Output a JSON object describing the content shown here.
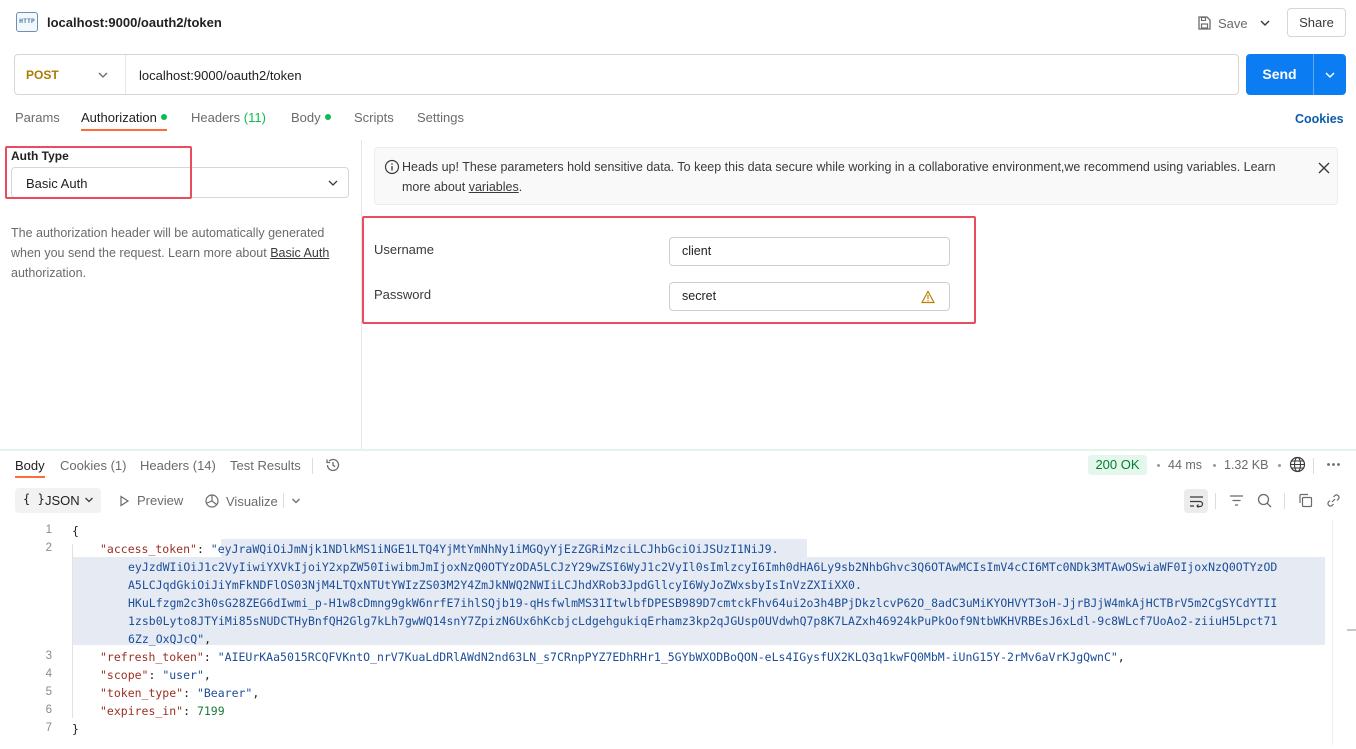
{
  "request": {
    "title": "localhost:9000/oauth2/token",
    "icon": "http-request-icon",
    "icon_text": "HTTP",
    "save_label": "Save",
    "share_label": "Share",
    "method": "POST",
    "url": "localhost:9000/oauth2/token",
    "send_label": "Send"
  },
  "tabs": [
    {
      "label": "Params"
    },
    {
      "label": "Authorization",
      "active": true,
      "dot": true
    },
    {
      "label": "Headers",
      "count": "(11)"
    },
    {
      "label": "Body",
      "dot": true
    },
    {
      "label": "Scripts"
    },
    {
      "label": "Settings"
    }
  ],
  "cookies_label": "Cookies",
  "auth": {
    "type_label": "Auth Type",
    "type_value": "Basic Auth",
    "description_pre": "The authorization header will be automatically generated when you send the request. Learn more about ",
    "description_link": "Basic Auth",
    "description_post": " authorization.",
    "notice_pre": "Heads up! These parameters hold sensitive data. To keep this data secure while working in a collaborative environment,we recommend using variables. Learn more about ",
    "notice_link": "variables",
    "notice_post": ".",
    "username_label": "Username",
    "username_value": "client",
    "password_label": "Password",
    "password_value": "secret"
  },
  "response": {
    "tabs": [
      {
        "label": "Body",
        "active": true
      },
      {
        "label": "Cookies (1)"
      },
      {
        "label": "Headers (14)"
      },
      {
        "label": "Test Results"
      }
    ],
    "status": "200 OK",
    "time": "44 ms",
    "size": "1.32 KB",
    "format": "JSON",
    "format_brace": "{ }",
    "preview_label": "Preview",
    "visualize_label": "Visualize",
    "line_numbers": [
      "1",
      "2",
      "3",
      "4",
      "5",
      "6",
      "7"
    ],
    "code": {
      "open": "{",
      "close": "}",
      "access_token_key": "\"access_token\"",
      "access_token_lines": [
        "\"eyJraWQiOiJmNjk1NDlkMS1iNGE1LTQ4YjMtYmNhNy1iMGQyYjEzZGRiMzciLCJhbGciOiJSUzI1NiJ9.",
        "eyJzdWIiOiJ1c2VyIiwiYXVkIjoiY2xpZW50IiwibmJmIjoxNzQ0OTYzODA5LCJzY29wZSI6WyJ1c2VyIl0sImlzcyI6Imh0dHA6Ly9sb2NhbGhvc3Q6OTAwMCIsImV4cCI6MTc0NDk3MTAwOSwiaWF0IjoxNzQ0OTYzOD",
        "A5LCJqdGkiOiJiYmFkNDFlOS03NjM4LTQxNTUtYWIzZS03M2Y4ZmJkNWQ2NWIiLCJhdXRob3JpdGllcyI6WyJoZWxsbyIsInVzZXIiXX0.",
        "HKuLfzgm2c3h0sG28ZEG6dIwmi_p-H1w8cDmng9gkW6nrfE7ihlSQjb19-qHsfwlmMS31ItwlbfDPESB989D7cmtckFhv64ui2o3h4BPjDkzlcvP62O_8adC3uMiKYOHVYT3oH-JjrBJjW4mkAjHCTBrV5m2CgSYCdYTII",
        "1zsb0Lyto8JTYiMi85sNUDCTHyBnfQH2Glg7kLh7gwWQ14snY7ZpizN6Ux6hKcbjcLdgehgukiqErhamz3kp2qJGUsp0UVdwhQ7p8K7LAZxh46924kPuPkOof9NtbWKHVRBEsJ6xLdl-9c8WLcf7UoAo2-ziiuH5Lpct71",
        "6Zz_OxQJcQ\""
      ],
      "refresh_token_key": "\"refresh_token\"",
      "refresh_token_value": "\"AIEUrKAa5015RCQFVKntO_nrV7KuaLdDRlAWdN2nd63LN_s7CRnpPYZ7EDhRHr1_5GYbWXODBoQON-eLs4IGysfUX2KLQ3q1kwFQ0MbM-iUnG15Y-2rMv6aVrKJgQwnC\"",
      "scope_key": "\"scope\"",
      "scope_value": "\"user\"",
      "token_type_key": "\"token_type\"",
      "token_type_value": "\"Bearer\"",
      "expires_in_key": "\"expires_in\"",
      "expires_in_value": "7199",
      "colon": ": ",
      "comma": ","
    }
  },
  "colors": {
    "send": "#0c7cf2",
    "accent_tab": "#ff6c37",
    "method": "#ad7a03",
    "status_ok": "#007f31",
    "highlight_box": "#ea4c5f"
  }
}
